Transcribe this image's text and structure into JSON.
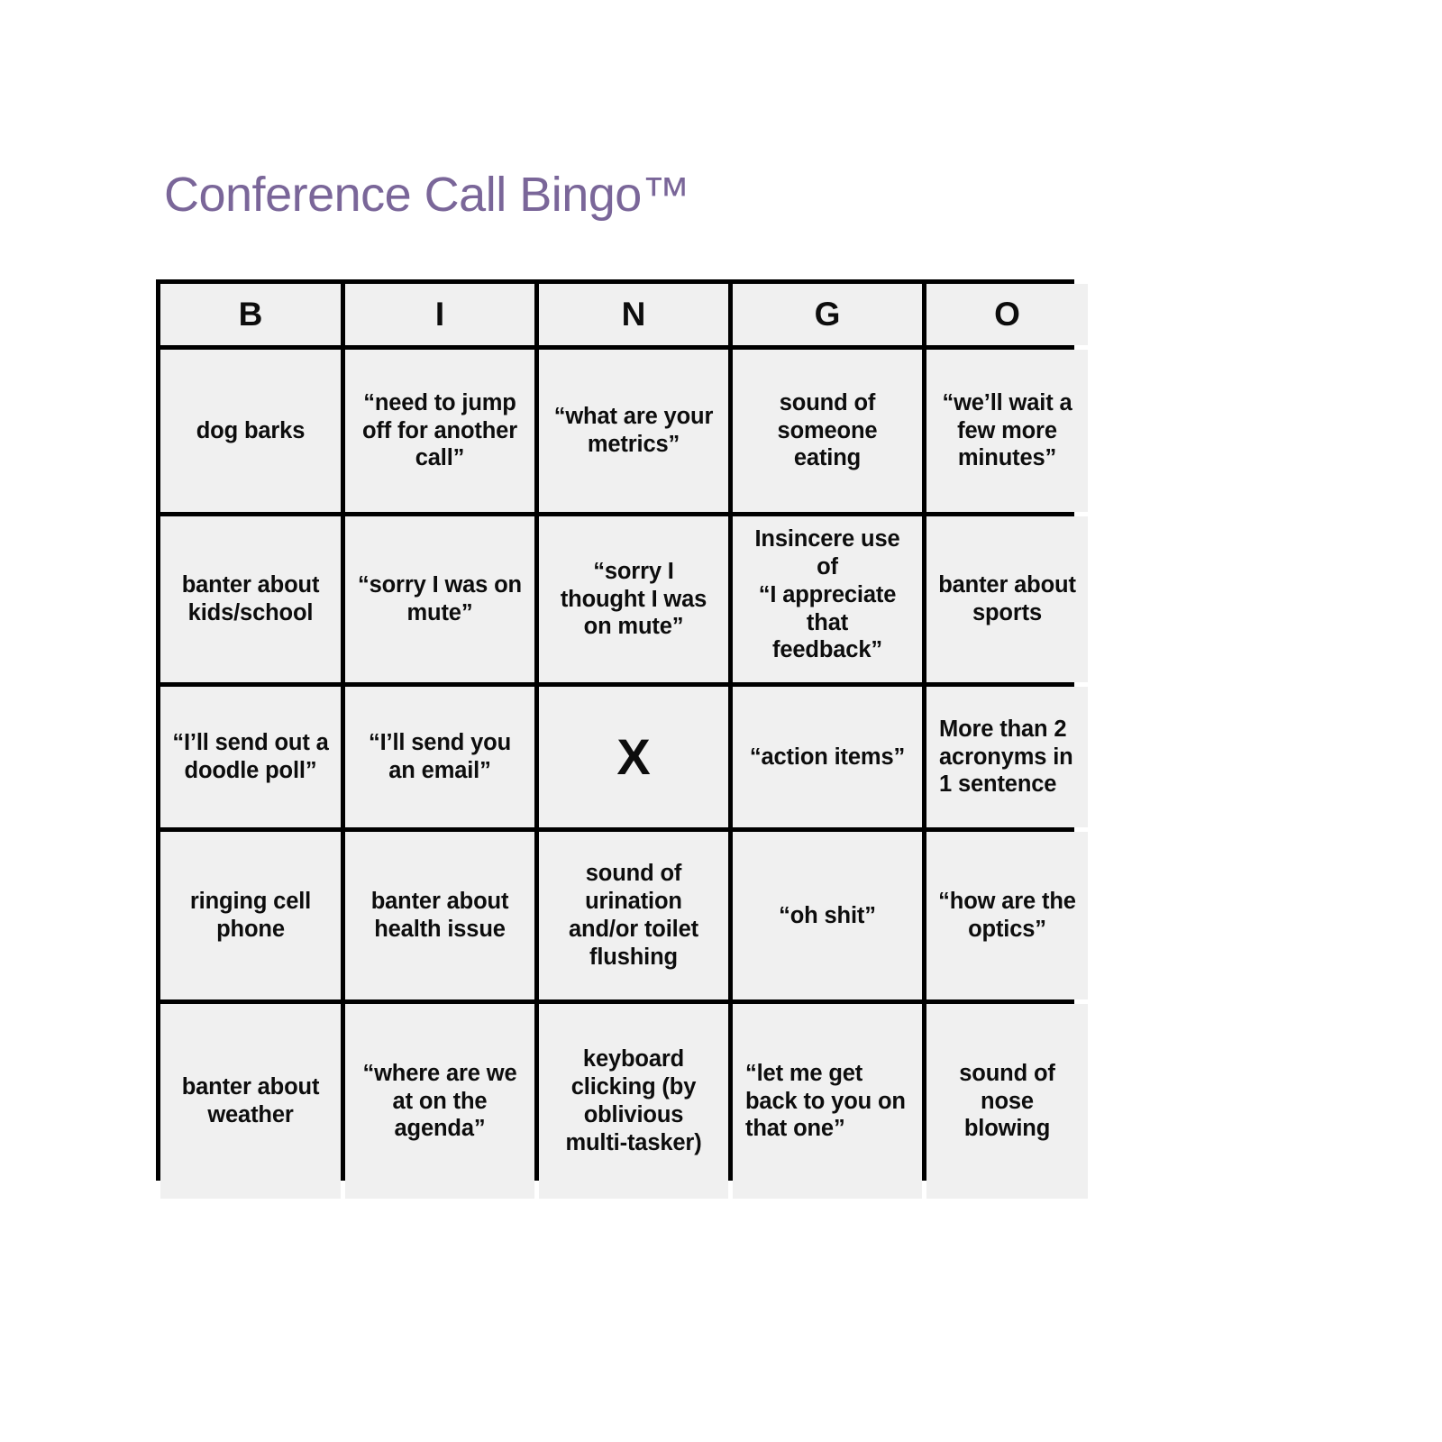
{
  "title": "Conference Call Bingo™",
  "colors": {
    "title": "#7a6699",
    "cell_background": "#f0f0f0",
    "grid_line": "#000000",
    "cell_text": "#0d0d0d",
    "page_background": "#ffffff"
  },
  "card": {
    "headers": [
      "B",
      "I",
      "N",
      "G",
      "O"
    ],
    "rows": [
      [
        "dog barks",
        "“need to jump\noff for another\ncall”",
        "“what are your\nmetrics”",
        "sound of\nsomeone\neating",
        "“we’ll wait a\nfew more\nminutes”"
      ],
      [
        "banter about\nkids/school",
        "“sorry I was on\nmute”",
        "“sorry I\nthought I was\non mute”",
        "Insincere use\nof\n“I appreciate\nthat\nfeedback”",
        "banter about\nsports"
      ],
      [
        "“I’ll send out a\ndoodle poll”",
        "“I’ll send you\nan email”",
        "X",
        "“action items”",
        "More than 2\nacronyms in\n1 sentence"
      ],
      [
        "ringing cell\nphone",
        "banter about\nhealth issue",
        "sound of\nurination\nand/or toilet\nflushing",
        "“oh shit”",
        "“how are the\noptics”"
      ],
      [
        "banter about\nweather",
        "“where are we\nat on the\nagenda”",
        "keyboard\nclicking (by\noblivious\nmulti-tasker)",
        "“let me get\nback to you on\nthat one”",
        "sound of nose\nblowing"
      ]
    ],
    "free_space": {
      "row": 2,
      "col": 2,
      "marker": "X"
    }
  }
}
